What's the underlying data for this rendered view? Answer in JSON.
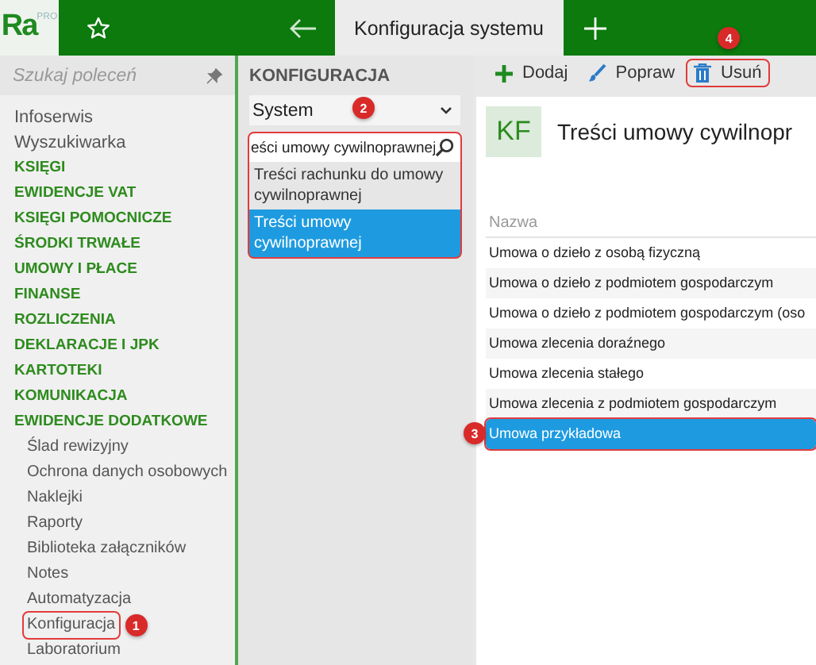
{
  "topbar": {
    "logo": {
      "text": "Ra",
      "sup": "PRO"
    },
    "tab_title": "Konfiguracja systemu"
  },
  "sidebar": {
    "search": {
      "placeholder": "Szukaj poleceń"
    },
    "items": [
      {
        "label": "Infoserwis",
        "kind": "link"
      },
      {
        "label": "Wyszukiwarka",
        "kind": "link"
      },
      {
        "label": "KSIĘGI",
        "kind": "section"
      },
      {
        "label": "EWIDENCJE VAT",
        "kind": "section"
      },
      {
        "label": "KSIĘGI POMOCNICZE",
        "kind": "section"
      },
      {
        "label": "ŚRODKI TRWAŁE",
        "kind": "section"
      },
      {
        "label": "UMOWY I PŁACE",
        "kind": "section"
      },
      {
        "label": "FINANSE",
        "kind": "section"
      },
      {
        "label": "ROZLICZENIA",
        "kind": "section"
      },
      {
        "label": "DEKLARACJE I JPK",
        "kind": "section"
      },
      {
        "label": "KARTOTEKI",
        "kind": "section"
      },
      {
        "label": "KOMUNIKACJA",
        "kind": "section"
      },
      {
        "label": "EWIDENCJE DODATKOWE",
        "kind": "section",
        "children": [
          {
            "label": "Ślad rewizyjny"
          },
          {
            "label": "Ochrona danych osobowych"
          },
          {
            "label": "Naklejki"
          },
          {
            "label": "Raporty"
          },
          {
            "label": "Biblioteka załączników"
          },
          {
            "label": "Notes"
          },
          {
            "label": "Automatyzacja"
          },
          {
            "label": "Konfiguracja",
            "callout": "1"
          },
          {
            "label": "Laboratorium"
          }
        ]
      }
    ]
  },
  "config_panel": {
    "heading": "KONFIGURACJA",
    "dropdown": {
      "value": "System"
    },
    "search": {
      "value": "eści umowy cywilnoprawnej",
      "callout": "2"
    },
    "results": [
      {
        "label": "Treści rachunku do umowy cywilnoprawnej",
        "selected": false
      },
      {
        "label": "Treści umowy cywilnoprawnej",
        "selected": true
      }
    ]
  },
  "toolbar": [
    {
      "label": "Dodaj",
      "kind": "add"
    },
    {
      "label": "Popraw",
      "kind": "edit"
    },
    {
      "label": "Usuń",
      "kind": "delete",
      "callout": "4"
    }
  ],
  "content": {
    "badge": "KF",
    "title": "Treści umowy cywilnopr",
    "table": {
      "columns": [
        "Nazwa"
      ],
      "rows": [
        {
          "name": "Umowa o dzieło z osobą fizyczną",
          "selected": false
        },
        {
          "name": "Umowa o dzieło z podmiotem gospodarczym",
          "selected": false
        },
        {
          "name": "Umowa o dzieło z podmiotem gospodarczym (oso",
          "selected": false
        },
        {
          "name": "Umowa zlecenia doraźnego",
          "selected": false
        },
        {
          "name": "Umowa zlecenia stałego",
          "selected": false
        },
        {
          "name": "Umowa zlecenia z podmiotem gospodarczym",
          "selected": false
        },
        {
          "name": "Umowa przykładowa",
          "selected": true,
          "callout": "3"
        }
      ]
    }
  }
}
